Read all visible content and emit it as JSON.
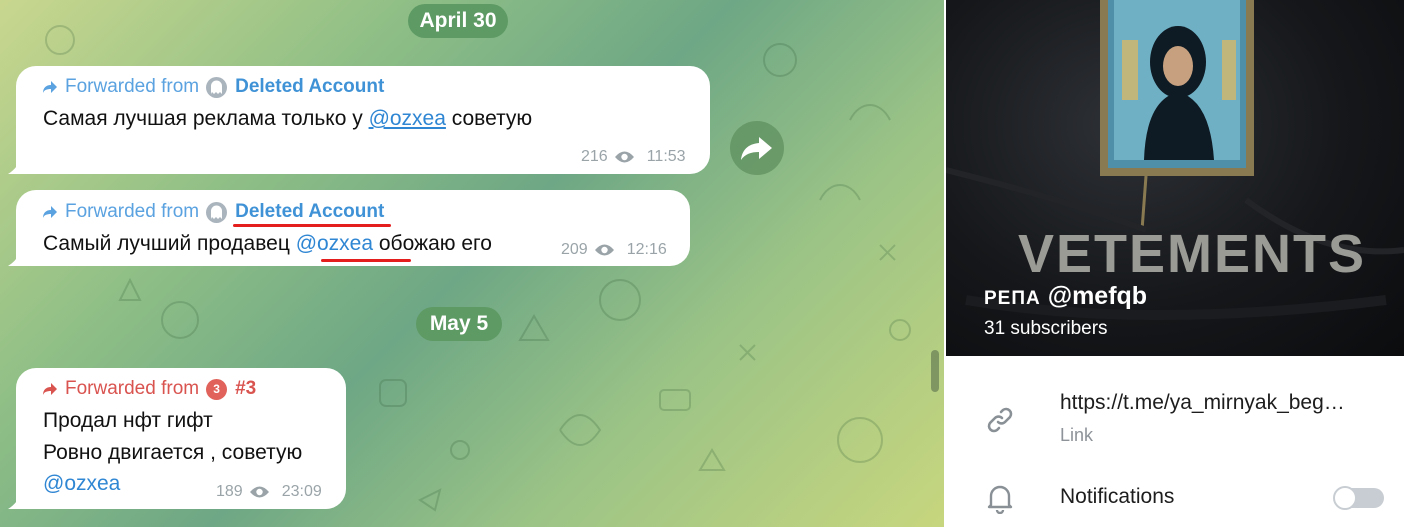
{
  "chat": {
    "date_separators": [
      "April 30",
      "May 5"
    ],
    "messages": [
      {
        "forwarded_label": "Forwarded from",
        "author": "Deleted Account",
        "text_before": "Самая лучшая реклама только у ",
        "mention": "@ozxea",
        "text_after": " советую",
        "views": "216",
        "time": "11:53"
      },
      {
        "forwarded_label": "Forwarded from",
        "author": "Deleted Account",
        "text_before": "Самый лучший продавец ",
        "mention": "@ozxea",
        "text_after": " обожаю его",
        "views": "209",
        "time": "12:16"
      },
      {
        "forwarded_label": "Forwarded from",
        "author_avatar_letter": "3",
        "author": "#3",
        "line1": "Продал нфт гифт",
        "line2": "Ровно двигается , советую",
        "mention": "@ozxea",
        "views": "189",
        "time": "23:09"
      }
    ],
    "icons": [
      "forward-arrow-icon",
      "ghost-avatar-icon",
      "eye-icon",
      "share-icon"
    ],
    "colors": {
      "accent": "#3f92d6",
      "red_author": "#d9534f",
      "highlight_underline": "#e41d1d",
      "date_pill": "#5e9a64"
    }
  },
  "profile": {
    "cover_caption": "VETEMENTS",
    "name_prefix": "РЕПА",
    "name_handle": "@mefqb",
    "subscribers": "31 subscribers",
    "link_value": "https://t.me/ya_mirnyak_beg…",
    "link_label": "Link",
    "notifications_label": "Notifications",
    "notifications_enabled": false,
    "icons": [
      "link-icon",
      "bell-icon"
    ]
  }
}
